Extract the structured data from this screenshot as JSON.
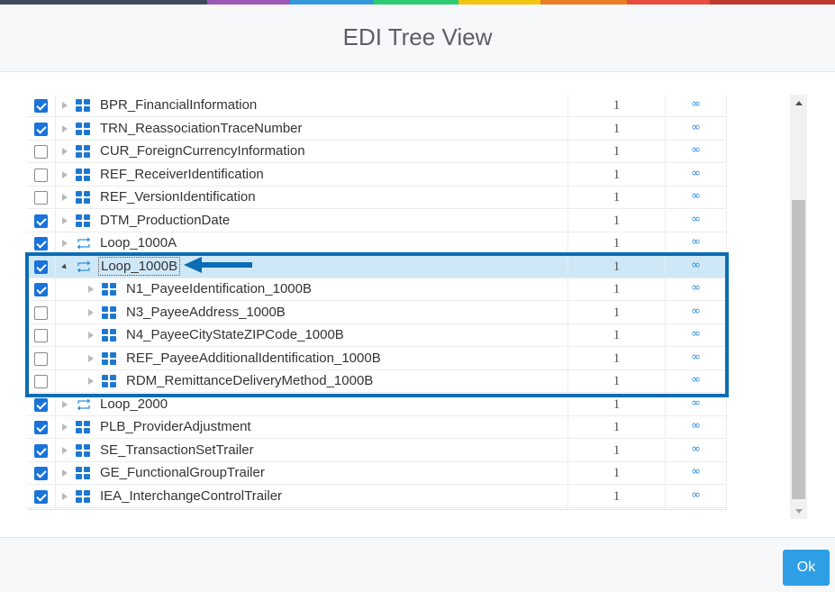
{
  "header": {
    "title": "EDI Tree View"
  },
  "colors": {
    "strip": [
      "#3e4a5a",
      "#9b59b6",
      "#3498db",
      "#2ecc71",
      "#f1c40f",
      "#e67e22",
      "#e74c3c",
      "#c0392b"
    ],
    "accent": "#0a6db5",
    "checkbox": "#1a73d9",
    "node_icon": "#1e78d0",
    "selected_row": "#cfe8f7",
    "ok_button": "#2e9fe5"
  },
  "tree": {
    "rows": [
      {
        "label": "BPR_FinancialInformation",
        "checked": true,
        "level": 0,
        "icon": "grid-icon",
        "expanded": false,
        "count": "1"
      },
      {
        "label": "TRN_ReassociationTraceNumber",
        "checked": true,
        "level": 0,
        "icon": "grid-icon",
        "expanded": false,
        "count": "1"
      },
      {
        "label": "CUR_ForeignCurrencyInformation",
        "checked": false,
        "level": 0,
        "icon": "grid-icon",
        "expanded": false,
        "count": "1"
      },
      {
        "label": "REF_ReceiverIdentification",
        "checked": false,
        "level": 0,
        "icon": "grid-icon",
        "expanded": false,
        "count": "1"
      },
      {
        "label": "REF_VersionIdentification",
        "checked": false,
        "level": 0,
        "icon": "grid-icon",
        "expanded": false,
        "count": "1"
      },
      {
        "label": "DTM_ProductionDate",
        "checked": true,
        "level": 0,
        "icon": "grid-icon",
        "expanded": false,
        "count": "1"
      },
      {
        "label": "Loop_1000A",
        "checked": true,
        "level": 0,
        "icon": "loop-icon",
        "expanded": false,
        "count": "1"
      },
      {
        "label": "Loop_1000B",
        "checked": true,
        "level": 0,
        "icon": "loop-icon",
        "expanded": true,
        "selected": true,
        "count": "1"
      },
      {
        "label": "N1_PayeeIdentification_1000B",
        "checked": true,
        "level": 1,
        "icon": "grid-icon",
        "expanded": false,
        "count": "1"
      },
      {
        "label": "N3_PayeeAddress_1000B",
        "checked": false,
        "level": 1,
        "icon": "grid-icon",
        "expanded": false,
        "count": "1"
      },
      {
        "label": "N4_PayeeCityStateZIPCode_1000B",
        "checked": false,
        "level": 1,
        "icon": "grid-icon",
        "expanded": false,
        "count": "1"
      },
      {
        "label": "REF_PayeeAdditionalIdentification_1000B",
        "checked": false,
        "level": 1,
        "icon": "grid-icon",
        "expanded": false,
        "count": "1"
      },
      {
        "label": "RDM_RemittanceDeliveryMethod_1000B",
        "checked": false,
        "level": 1,
        "icon": "grid-icon",
        "expanded": false,
        "count": "1"
      },
      {
        "label": "Loop_2000",
        "checked": true,
        "level": 0,
        "icon": "loop-icon",
        "expanded": false,
        "count": "1"
      },
      {
        "label": "PLB_ProviderAdjustment",
        "checked": true,
        "level": 0,
        "icon": "grid-icon",
        "expanded": false,
        "count": "1"
      },
      {
        "label": "SE_TransactionSetTrailer",
        "checked": true,
        "level": 0,
        "icon": "grid-icon",
        "expanded": false,
        "count": "1"
      },
      {
        "label": "GE_FunctionalGroupTrailer",
        "checked": true,
        "level": 0,
        "icon": "grid-icon",
        "expanded": false,
        "count": "1"
      },
      {
        "label": "IEA_InterchangeControlTrailer",
        "checked": true,
        "level": 0,
        "icon": "grid-icon",
        "expanded": false,
        "count": "1"
      }
    ]
  },
  "link_icon": {
    "glyph": "∞",
    "name": "infinity-link-icon"
  },
  "footer": {
    "ok_label": "Ok"
  }
}
